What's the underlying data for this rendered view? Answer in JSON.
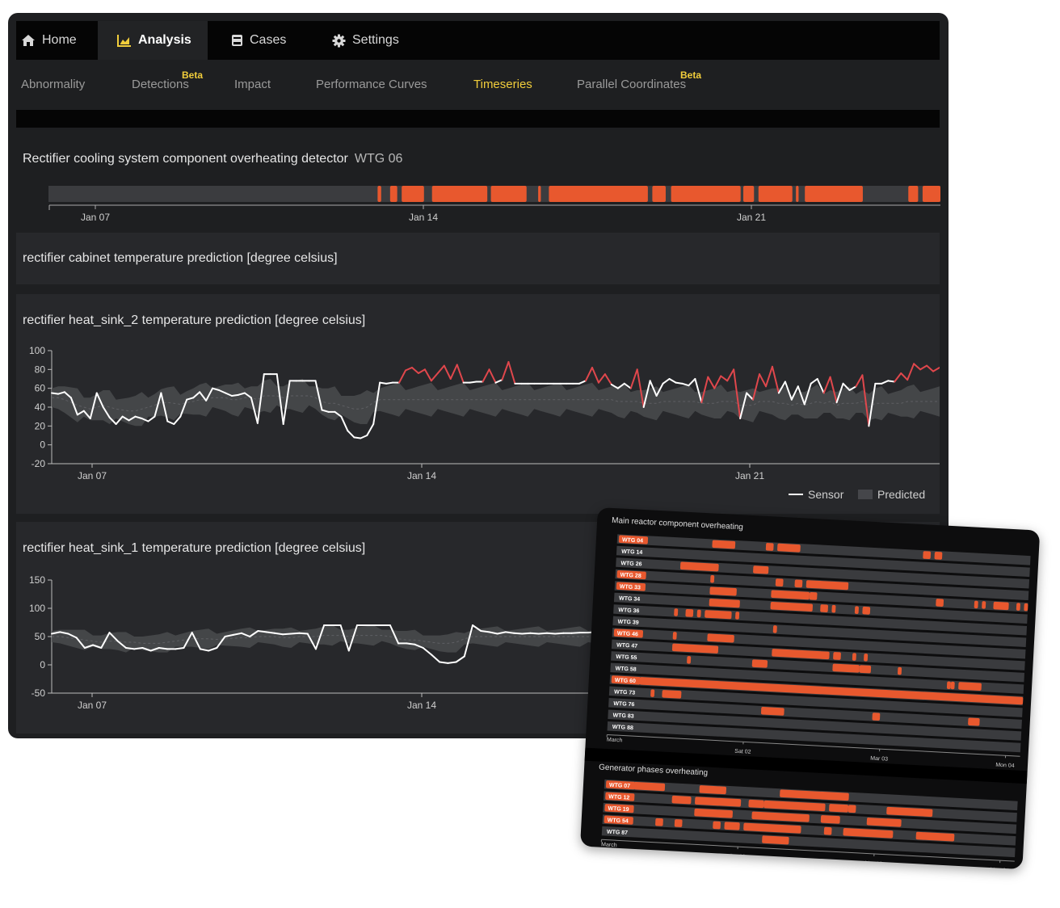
{
  "nav": {
    "tabs": [
      {
        "label": "Home",
        "icon": "home-icon"
      },
      {
        "label": "Analysis",
        "icon": "chart-icon",
        "active": true
      },
      {
        "label": "Cases",
        "icon": "book-icon"
      },
      {
        "label": "Settings",
        "icon": "gear-icon"
      }
    ]
  },
  "subnav": {
    "tabs": [
      {
        "label": "Abnormality"
      },
      {
        "label": "Detections",
        "badge": "Beta"
      },
      {
        "label": "Impact"
      },
      {
        "label": "Performance Curves"
      },
      {
        "label": "Timeseries",
        "active": true
      },
      {
        "label": "Parallel Coordinates",
        "badge": "Beta"
      }
    ]
  },
  "detector": {
    "title": "Rectifier cooling system component overheating detector",
    "turbine": "WTG 06",
    "ticks": [
      "Jan 07",
      "Jan 14",
      "Jan 21"
    ],
    "detections": [
      {
        "start": 0.369,
        "end": 0.373
      },
      {
        "start": 0.383,
        "end": 0.391
      },
      {
        "start": 0.396,
        "end": 0.421
      },
      {
        "start": 0.43,
        "end": 0.492
      },
      {
        "start": 0.496,
        "end": 0.536
      },
      {
        "start": 0.549,
        "end": 0.552
      },
      {
        "start": 0.561,
        "end": 0.672
      },
      {
        "start": 0.677,
        "end": 0.692
      },
      {
        "start": 0.698,
        "end": 0.776
      },
      {
        "start": 0.779,
        "end": 0.791
      },
      {
        "start": 0.796,
        "end": 0.834
      },
      {
        "start": 0.838,
        "end": 0.841
      },
      {
        "start": 0.848,
        "end": 0.913
      },
      {
        "start": 0.964,
        "end": 0.975
      },
      {
        "start": 0.98,
        "end": 1.0
      }
    ]
  },
  "panels": {
    "cabinet": {
      "title": "rectifier cabinet temperature prediction [degree celsius]"
    },
    "heatsink2": {
      "title": "rectifier heat_sink_2 temperature prediction [degree celsius]"
    },
    "heatsink1": {
      "title": "rectifier heat_sink_1 temperature prediction [degree celsius]"
    }
  },
  "legend": {
    "sensor": "Sensor",
    "predicted": "Predicted"
  },
  "colors": {
    "detection": "#e8582e",
    "sensor": "#ffffff",
    "anomaly": "#e0474c",
    "band": "#4a4b4e",
    "beta": "#f1cd3b"
  },
  "chart_data": [
    {
      "type": "line",
      "title": "rectifier heat_sink_2 temperature prediction [degree celsius]",
      "x_ticks": [
        "Jan 07",
        "Jan 14",
        "Jan 21"
      ],
      "ylim": [
        -20,
        100
      ],
      "y_ticks": [
        100,
        80,
        60,
        40,
        20,
        0,
        -20
      ],
      "series": [
        {
          "name": "Sensor",
          "values": [
            55,
            54,
            56,
            50,
            32,
            36,
            28,
            55,
            40,
            29,
            22,
            30,
            26,
            30,
            28,
            25,
            30,
            55,
            25,
            22,
            30,
            48,
            50,
            56,
            47,
            60,
            58,
            55,
            52,
            53,
            55,
            50,
            23,
            75,
            75,
            75,
            22,
            68,
            68,
            68,
            68,
            68,
            37,
            35,
            35,
            30,
            15,
            8,
            7,
            10,
            22,
            66,
            65,
            66,
            66,
            79,
            82,
            76,
            80,
            68,
            76,
            84,
            70,
            85,
            66,
            66,
            67,
            67,
            80,
            66,
            69,
            88,
            65,
            65,
            65,
            65,
            65,
            65,
            65,
            65,
            65,
            65,
            65,
            68,
            82,
            66,
            75,
            64,
            60,
            65,
            60,
            80,
            40,
            68,
            52,
            65,
            70,
            66,
            65,
            63,
            70,
            45,
            72,
            60,
            73,
            68,
            80,
            28,
            55,
            48,
            75,
            62,
            83,
            55,
            67,
            48,
            62,
            43,
            65,
            70,
            55,
            72,
            45,
            65,
            58,
            62,
            74,
            20,
            65,
            65,
            68,
            67,
            76,
            69,
            86,
            80,
            84,
            78,
            82
          ]
        },
        {
          "name": "Predicted",
          "values": [
            50,
            50,
            48,
            45,
            42,
            40,
            38,
            40,
            42,
            40,
            38,
            37,
            36,
            36,
            38,
            40,
            42,
            45,
            45,
            44,
            43,
            45,
            46,
            48,
            48,
            50,
            50,
            50,
            48,
            48,
            50,
            50,
            48,
            52,
            52,
            52,
            50,
            52,
            52,
            52,
            52,
            50,
            46,
            44,
            44,
            42,
            40,
            38,
            38,
            40,
            45,
            48,
            48,
            48,
            48,
            48,
            48,
            48,
            48,
            48,
            48,
            48,
            48,
            48,
            48,
            48,
            48,
            48,
            48,
            48,
            48,
            48,
            48,
            48,
            48,
            48,
            48,
            48,
            48,
            48,
            48,
            48,
            48,
            48,
            48,
            48,
            48,
            48,
            46,
            46,
            46,
            46,
            44,
            44,
            44,
            46,
            46,
            46,
            46,
            46,
            46,
            44,
            44,
            44,
            46,
            46,
            46,
            42,
            42,
            42,
            46,
            46,
            46,
            44,
            44,
            42,
            44,
            42,
            44,
            46,
            44,
            46,
            42,
            44,
            44,
            44,
            46,
            40,
            44,
            44,
            44,
            44,
            44,
            46,
            46,
            46,
            46,
            46,
            46
          ]
        }
      ]
    },
    {
      "type": "line",
      "title": "rectifier heat_sink_1 temperature prediction [degree celsius]",
      "x_ticks": [
        "Jan 07",
        "Jan 14"
      ],
      "ylim": [
        -50,
        150
      ],
      "y_ticks": [
        150,
        100,
        50,
        0,
        -50
      ],
      "series": [
        {
          "name": "Sensor",
          "values": [
            55,
            58,
            55,
            48,
            30,
            35,
            30,
            57,
            42,
            30,
            28,
            30,
            25,
            30,
            28,
            28,
            30,
            57,
            28,
            25,
            30,
            50,
            53,
            56,
            50,
            60,
            58,
            56,
            54,
            55,
            56,
            55,
            28,
            70,
            70,
            70,
            25,
            70,
            70,
            70,
            70,
            70,
            38,
            38,
            36,
            30,
            18,
            5,
            3,
            5,
            15,
            70,
            60,
            58,
            55,
            58,
            56,
            55,
            56,
            55,
            56,
            55,
            56,
            56,
            57,
            57,
            58,
            58,
            58,
            58,
            58,
            58
          ]
        },
        {
          "name": "Predicted",
          "values": [
            50,
            50,
            48,
            46,
            44,
            42,
            40,
            42,
            42,
            40,
            40,
            38,
            38,
            38,
            40,
            42,
            44,
            46,
            46,
            46,
            45,
            46,
            47,
            48,
            48,
            50,
            50,
            50,
            48,
            48,
            50,
            50,
            50,
            52,
            52,
            52,
            50,
            52,
            52,
            52,
            52,
            50,
            46,
            44,
            44,
            42,
            40,
            38,
            38,
            40,
            46,
            50,
            50,
            50,
            50,
            50,
            50,
            50,
            50,
            50,
            50,
            50,
            50,
            50,
            50,
            50,
            50,
            50,
            50,
            50,
            50,
            50
          ]
        }
      ]
    },
    {
      "type": "gantt",
      "title": "Main reactor component overheating",
      "x_ticks": [
        "March",
        "Sat 02",
        "Mar 03",
        "Mon 04"
      ],
      "rows": [
        {
          "label": "WTG 04",
          "highlight": true,
          "bars": [
            [
              0.17,
              0.23
            ],
            [
              0.31,
              0.33
            ],
            [
              0.34,
              0.4
            ],
            [
              0.72,
              0.74
            ],
            [
              0.75,
              0.77
            ]
          ]
        },
        {
          "label": "WTG 14",
          "highlight": false,
          "bars": []
        },
        {
          "label": "WTG 26",
          "highlight": false,
          "bars": [
            [
              0.09,
              0.19
            ],
            [
              0.28,
              0.32
            ]
          ]
        },
        {
          "label": "WTG 28",
          "highlight": true,
          "bars": [
            [
              0.17,
              0.18
            ],
            [
              0.34,
              0.36
            ],
            [
              0.39,
              0.41
            ],
            [
              0.42,
              0.53
            ]
          ]
        },
        {
          "label": "WTG 33",
          "highlight": true,
          "bars": [
            [
              0.17,
              0.24
            ],
            [
              0.33,
              0.43
            ],
            [
              0.43,
              0.45
            ],
            [
              0.76,
              0.78
            ],
            [
              0.86,
              0.87
            ],
            [
              0.88,
              0.89
            ],
            [
              0.91,
              0.95
            ],
            [
              0.97,
              0.98
            ],
            [
              0.99,
              1.0
            ]
          ]
        },
        {
          "label": "WTG 34",
          "highlight": false,
          "bars": [
            [
              0.17,
              0.25
            ],
            [
              0.33,
              0.44
            ],
            [
              0.46,
              0.48
            ],
            [
              0.49,
              0.5
            ],
            [
              0.55,
              0.56
            ],
            [
              0.57,
              0.59
            ]
          ]
        },
        {
          "label": "WTG 36",
          "highlight": false,
          "bars": [
            [
              0.08,
              0.09
            ],
            [
              0.11,
              0.13
            ],
            [
              0.14,
              0.15
            ],
            [
              0.16,
              0.23
            ],
            [
              0.24,
              0.25
            ]
          ]
        },
        {
          "label": "WTG 39",
          "highlight": false,
          "bars": [
            [
              0.34,
              0.35
            ]
          ]
        },
        {
          "label": "WTG 46",
          "highlight": true,
          "bars": [
            [
              0.08,
              0.09
            ],
            [
              0.17,
              0.24
            ]
          ]
        },
        {
          "label": "WTG 47",
          "highlight": false,
          "bars": [
            [
              0.08,
              0.2
            ],
            [
              0.34,
              0.49
            ],
            [
              0.5,
              0.52
            ],
            [
              0.55,
              0.56
            ],
            [
              0.58,
              0.59
            ]
          ]
        },
        {
          "label": "WTG 55",
          "highlight": false,
          "bars": [
            [
              0.12,
              0.13
            ],
            [
              0.29,
              0.33
            ],
            [
              0.5,
              0.57
            ],
            [
              0.57,
              0.6
            ],
            [
              0.67,
              0.68
            ]
          ]
        },
        {
          "label": "WTG 58",
          "highlight": false,
          "bars": [
            [
              0.8,
              0.81
            ],
            [
              0.81,
              0.82
            ],
            [
              0.83,
              0.89
            ]
          ]
        },
        {
          "label": "WTG 60",
          "highlight": true,
          "bars": [
            [
              0.0,
              1.0
            ]
          ]
        },
        {
          "label": "WTG 73",
          "highlight": false,
          "bars": [
            [
              0.03,
              0.04
            ],
            [
              0.06,
              0.11
            ]
          ]
        },
        {
          "label": "WTG 76",
          "highlight": false,
          "bars": [
            [
              0.32,
              0.38
            ],
            [
              0.61,
              0.63
            ],
            [
              0.86,
              0.89
            ]
          ]
        },
        {
          "label": "WTG 83",
          "highlight": false,
          "bars": []
        },
        {
          "label": "WTG 88",
          "highlight": false,
          "bars": []
        }
      ]
    },
    {
      "type": "gantt",
      "title": "Generator phases overheating",
      "x_ticks": [
        "March",
        "Sat 02",
        "Mar 03",
        "Mon 04"
      ],
      "rows": [
        {
          "label": "WTG 07",
          "highlight": true,
          "bars": [
            [
              0.0,
              0.08
            ],
            [
              0.17,
              0.24
            ],
            [
              0.38,
              0.56
            ]
          ]
        },
        {
          "label": "WTG 12",
          "highlight": true,
          "bars": [
            [
              0.1,
              0.15
            ],
            [
              0.16,
              0.28
            ],
            [
              0.3,
              0.34
            ],
            [
              0.34,
              0.5
            ],
            [
              0.51,
              0.56
            ],
            [
              0.56,
              0.58
            ],
            [
              0.66,
              0.78
            ]
          ]
        },
        {
          "label": "WTG 19",
          "highlight": true,
          "bars": [
            [
              0.16,
              0.26
            ],
            [
              0.31,
              0.46
            ],
            [
              0.49,
              0.54
            ],
            [
              0.61,
              0.7
            ]
          ]
        },
        {
          "label": "WTG 54",
          "highlight": true,
          "bars": [
            [
              0.06,
              0.08
            ],
            [
              0.11,
              0.13
            ],
            [
              0.21,
              0.23
            ],
            [
              0.24,
              0.28
            ],
            [
              0.29,
              0.44
            ],
            [
              0.5,
              0.52
            ],
            [
              0.55,
              0.68
            ],
            [
              0.74,
              0.84
            ]
          ]
        },
        {
          "label": "WTG 87",
          "highlight": false,
          "bars": [
            [
              0.34,
              0.41
            ]
          ]
        }
      ]
    }
  ]
}
